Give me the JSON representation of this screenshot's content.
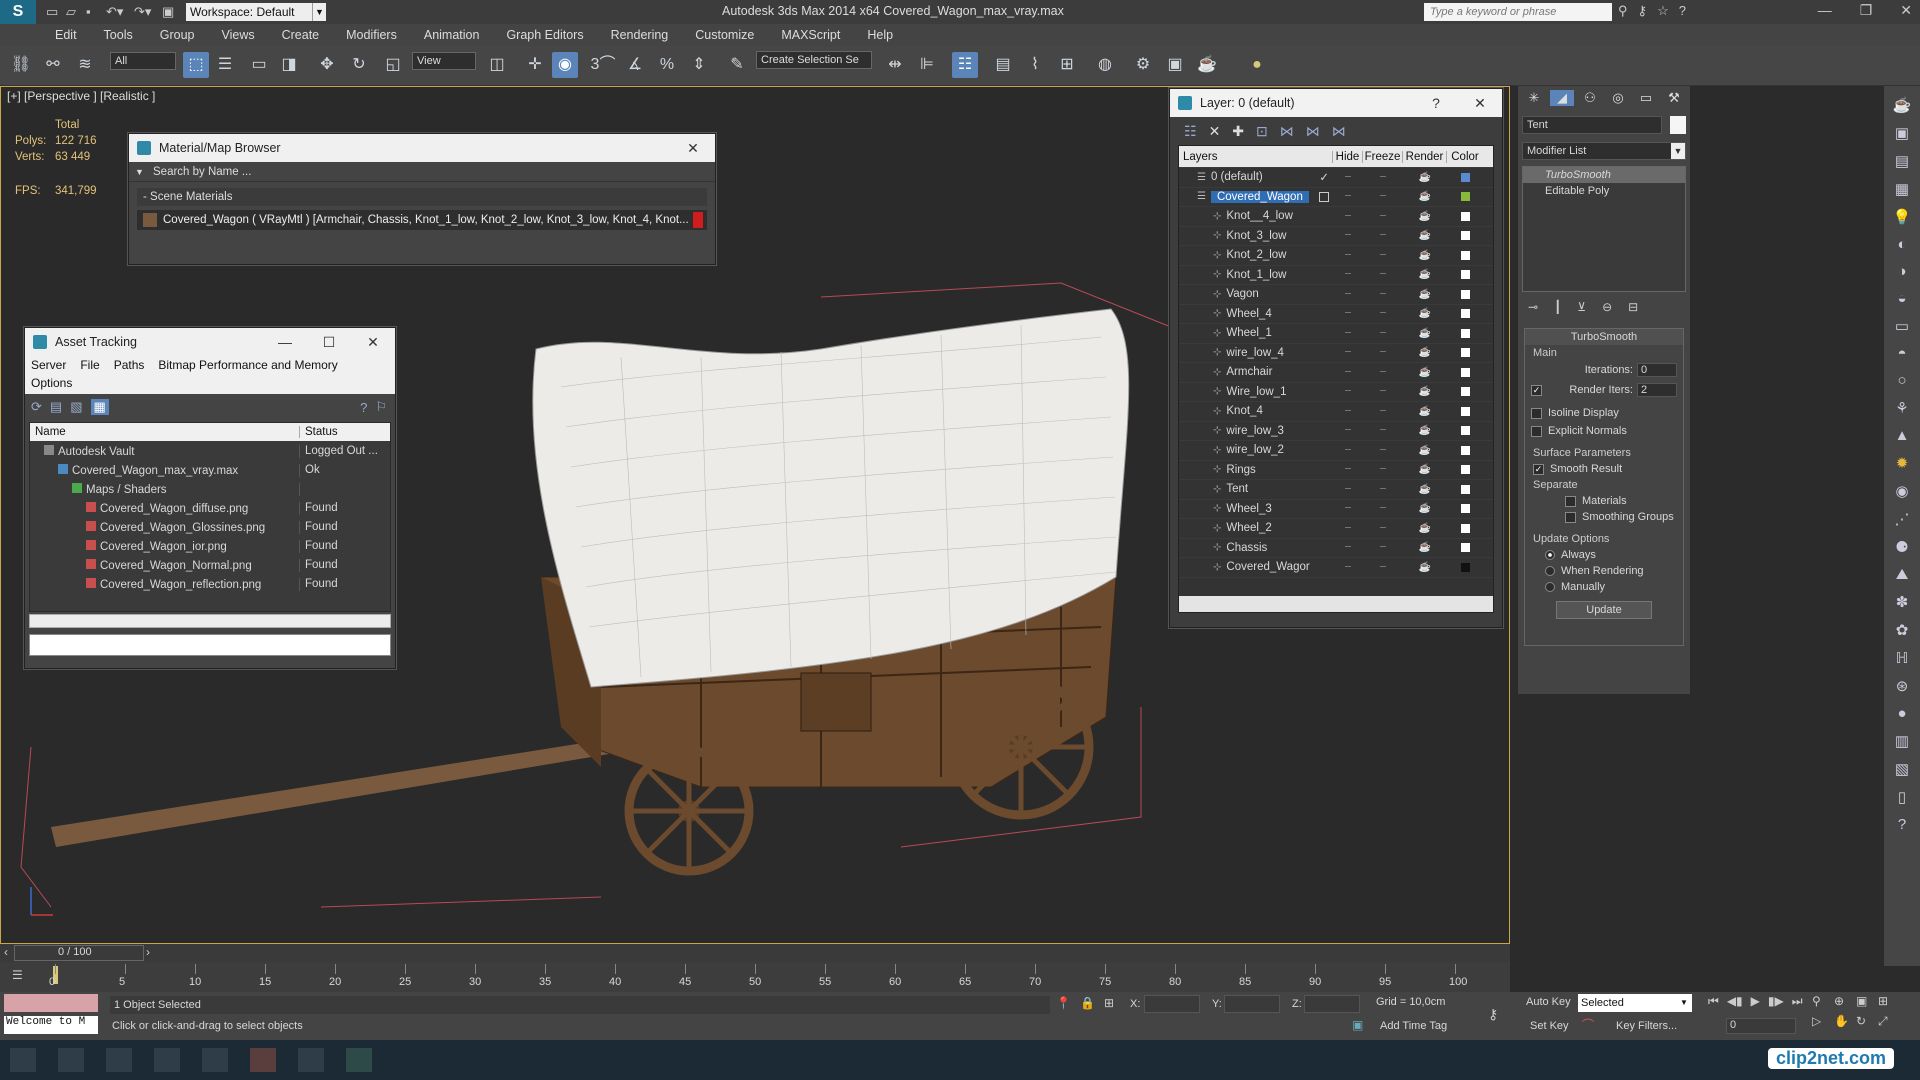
{
  "app": {
    "title": "Autodesk 3ds Max  2014 x64     Covered_Wagon_max_vray.max",
    "workspace": "Workspace: Default",
    "search_placeholder": "Type a keyword or phrase"
  },
  "menu": [
    "Edit",
    "Tools",
    "Group",
    "Views",
    "Create",
    "Modifiers",
    "Animation",
    "Graph Editors",
    "Rendering",
    "Customize",
    "MAXScript",
    "Help"
  ],
  "toolbar": {
    "filter": "All",
    "refcoord": "View",
    "selection_set": "Create Selection Se"
  },
  "viewport": {
    "label": "[+] [Perspective ] [Realistic ]",
    "stats": {
      "total_label": "Total",
      "polys_label": "Polys:",
      "polys": "122 716",
      "verts_label": "Verts:",
      "verts": "63 449",
      "fps_label": "FPS:",
      "fps": "341,799"
    }
  },
  "material_browser": {
    "title": "Material/Map Browser",
    "search": "Search by Name ...",
    "section": "- Scene Materials",
    "item": "Covered_Wagon  ( VRayMtl )  [Armchair, Chassis, Knot_1_low, Knot_2_low, Knot_3_low, Knot_4, Knot..."
  },
  "asset_tracking": {
    "title": "Asset Tracking",
    "menu": [
      "Server",
      "File",
      "Paths",
      "Bitmap Performance and Memory"
    ],
    "menu2": "Options",
    "columns": [
      "Name",
      "Status"
    ],
    "rows": [
      {
        "name": "Autodesk Vault",
        "status": "Logged Out ...",
        "indent": 1
      },
      {
        "name": "Covered_Wagon_max_vray.max",
        "status": "Ok",
        "indent": 2
      },
      {
        "name": "Maps / Shaders",
        "status": "",
        "indent": 3
      },
      {
        "name": "Covered_Wagon_diffuse.png",
        "status": "Found",
        "indent": 4
      },
      {
        "name": "Covered_Wagon_Glossines.png",
        "status": "Found",
        "indent": 4
      },
      {
        "name": "Covered_Wagon_ior.png",
        "status": "Found",
        "indent": 4
      },
      {
        "name": "Covered_Wagon_Normal.png",
        "status": "Found",
        "indent": 4
      },
      {
        "name": "Covered_Wagon_reflection.png",
        "status": "Found",
        "indent": 4
      }
    ]
  },
  "layers": {
    "title": "Layer: 0 (default)",
    "columns": [
      "Layers",
      "Hide",
      "Freeze",
      "Render",
      "Color"
    ],
    "rows": [
      {
        "name": "0 (default)",
        "level": 0,
        "color": "#5a8ad0",
        "check": true
      },
      {
        "name": "Covered_Wagon",
        "level": 0,
        "color": "#8ab83a",
        "selected": true
      },
      {
        "name": "Knot__4_low",
        "level": 1,
        "color": "#ffffff"
      },
      {
        "name": "Knot_3_low",
        "level": 1,
        "color": "#ffffff"
      },
      {
        "name": "Knot_2_low",
        "level": 1,
        "color": "#ffffff"
      },
      {
        "name": "Knot_1_low",
        "level": 1,
        "color": "#ffffff"
      },
      {
        "name": "Vagon",
        "level": 1,
        "color": "#ffffff"
      },
      {
        "name": "Wheel_4",
        "level": 1,
        "color": "#ffffff"
      },
      {
        "name": "Wheel_1",
        "level": 1,
        "color": "#ffffff"
      },
      {
        "name": "wire_low_4",
        "level": 1,
        "color": "#ffffff"
      },
      {
        "name": "Armchair",
        "level": 1,
        "color": "#ffffff"
      },
      {
        "name": "Wire_low_1",
        "level": 1,
        "color": "#ffffff"
      },
      {
        "name": "Knot_4",
        "level": 1,
        "color": "#ffffff"
      },
      {
        "name": "wire_low_3",
        "level": 1,
        "color": "#ffffff"
      },
      {
        "name": "wire_low_2",
        "level": 1,
        "color": "#ffffff"
      },
      {
        "name": "Rings",
        "level": 1,
        "color": "#ffffff"
      },
      {
        "name": "Tent",
        "level": 1,
        "color": "#ffffff"
      },
      {
        "name": "Wheel_3",
        "level": 1,
        "color": "#ffffff"
      },
      {
        "name": "Wheel_2",
        "level": 1,
        "color": "#ffffff"
      },
      {
        "name": "Chassis",
        "level": 1,
        "color": "#ffffff"
      },
      {
        "name": "Covered_Wagor",
        "level": 1,
        "color": "#111111"
      }
    ]
  },
  "command_panel": {
    "object_name": "Tent",
    "modifier_list": "Modifier List",
    "stack": [
      "TurboSmooth",
      "Editable Poly"
    ],
    "rollout": "TurboSmooth",
    "main": "Main",
    "iterations_label": "Iterations:",
    "iterations": "0",
    "render_iters_label": "Render Iters:",
    "render_iters": "2",
    "isoline": "Isoline Display",
    "explicit": "Explicit Normals",
    "surface": "Surface Parameters",
    "smooth": "Smooth Result",
    "separate": "Separate",
    "materials": "Materials",
    "smoothing_groups": "Smoothing Groups",
    "update_options": "Update Options",
    "always": "Always",
    "when_rendering": "When Rendering",
    "manually": "Manually",
    "update_btn": "Update"
  },
  "timeline": {
    "frame": "0 / 100",
    "ticks": [
      "0",
      "5",
      "10",
      "15",
      "20",
      "25",
      "30",
      "35",
      "40",
      "45",
      "50",
      "55",
      "60",
      "65",
      "70",
      "75",
      "80",
      "85",
      "90",
      "95",
      "100"
    ]
  },
  "status": {
    "welcome": "Welcome to M",
    "selected": "1 Object Selected",
    "prompt": "Click or click-and-drag to select objects",
    "x_label": "X:",
    "y_label": "Y:",
    "z_label": "Z:",
    "grid": "Grid = 10,0cm",
    "add_time_tag": "Add Time Tag",
    "auto_key": "Auto Key",
    "set_key": "Set Key",
    "selected_combo": "Selected",
    "key_filters": "Key Filters...",
    "frame_field": "0"
  },
  "watermark": "clip2net.com"
}
